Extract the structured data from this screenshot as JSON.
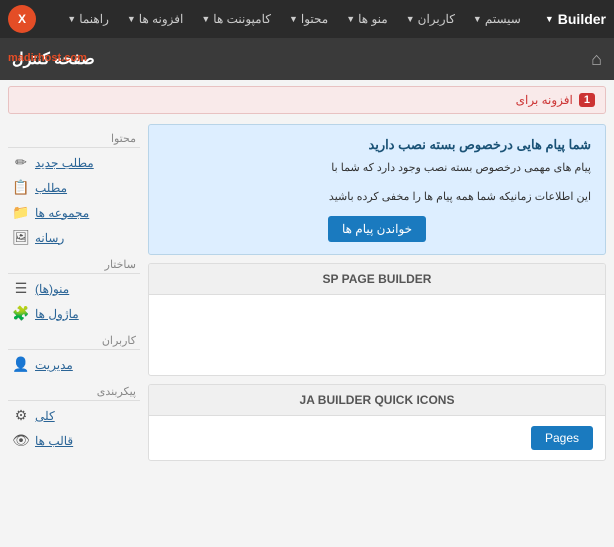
{
  "navbar": {
    "brand": "Builder",
    "joomla_icon": "X",
    "items": [
      {
        "label": "سیستم",
        "has_chevron": true
      },
      {
        "label": "کاربران",
        "has_chevron": true
      },
      {
        "label": "منو ها",
        "has_chevron": true
      },
      {
        "label": "محتوا",
        "has_chevron": true
      },
      {
        "label": "کامپوننت ها",
        "has_chevron": true
      },
      {
        "label": "افزونه ها",
        "has_chevron": true
      },
      {
        "label": "راهنما",
        "has_chevron": true
      }
    ]
  },
  "page_header": {
    "title": "صفحه کنترل",
    "home_icon": "⌂"
  },
  "madirhost": "madirhost.com",
  "alert": {
    "badge": "1",
    "text": "افزونه برای"
  },
  "notification": {
    "title": "شما پیام هایی درخصوص بسته نصب دارید",
    "text_line1": "پیام های مهمی درخصوص بسته نصب وجود دارد که شما با",
    "text_line2": "این اطلاعات زمانیکه شما همه پیام ها را مخفی کرده باشید",
    "read_button": "خواندن پیام ها"
  },
  "sp_panel": {
    "header": "SP PAGE BUILDER",
    "body": ""
  },
  "ja_panel": {
    "header": "JA BUILDER QUICK ICONS",
    "pages_button": "Pages"
  },
  "sidebar": {
    "sections": [
      {
        "label": "محتوا",
        "items": [
          {
            "label": "مطلب جدید",
            "icon": "✏",
            "link": true
          },
          {
            "label": "مطلب",
            "icon": "📋",
            "link": true
          },
          {
            "label": "مجموعه ها",
            "icon": "📁",
            "link": true
          },
          {
            "label": "رسانه",
            "icon": "🖼",
            "link": true
          }
        ]
      },
      {
        "label": "ساختار",
        "items": [
          {
            "label": "منو(ها)",
            "icon": "☰",
            "link": true
          },
          {
            "label": "ماژول ها",
            "icon": "🧊",
            "link": true
          }
        ]
      },
      {
        "label": "کاربران",
        "items": [
          {
            "label": "مدیریت",
            "icon": "👤",
            "link": true
          }
        ]
      },
      {
        "label": "پیکربندی",
        "items": [
          {
            "label": "کلی",
            "icon": "⚙",
            "link": true
          },
          {
            "label": "قالب ها",
            "icon": "👁",
            "link": true
          }
        ]
      }
    ]
  }
}
